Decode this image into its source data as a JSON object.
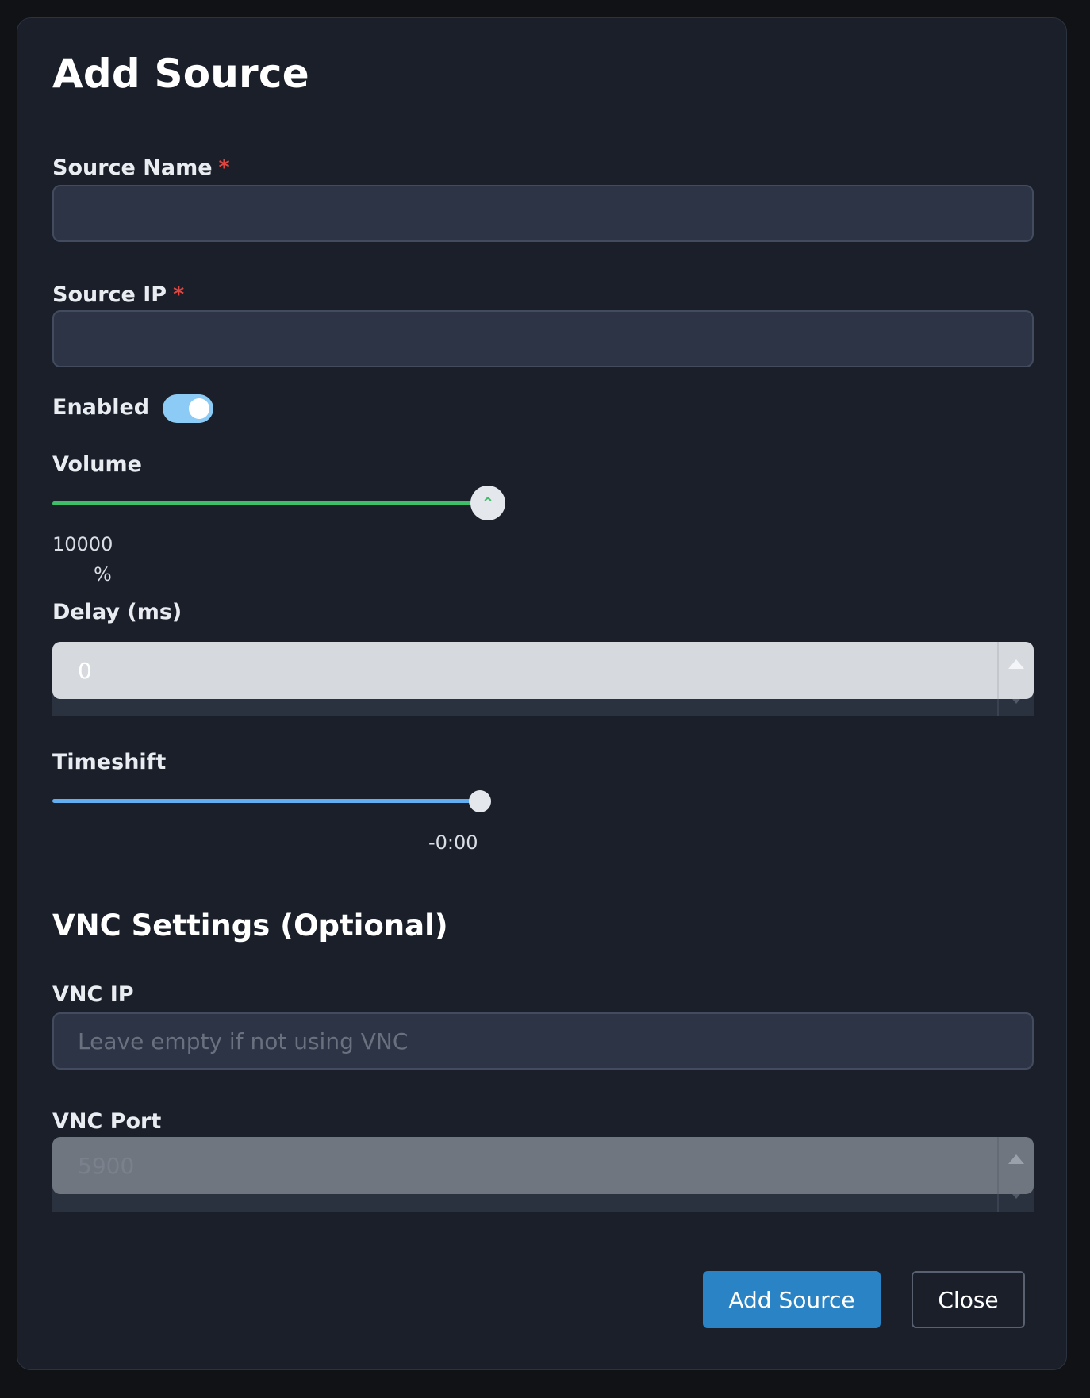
{
  "dialog": {
    "title": "Add Source",
    "source_name": {
      "label": "Source Name",
      "required_mark": "*",
      "value": ""
    },
    "source_ip": {
      "label": "Source IP",
      "required_mark": "*",
      "value": ""
    },
    "enabled": {
      "label": "Enabled",
      "on": true
    },
    "volume": {
      "label": "Volume",
      "value_text": "10000",
      "unit": "%",
      "level_fraction": 1.0
    },
    "delay": {
      "label": "Delay (ms)",
      "value": "0"
    },
    "timeshift": {
      "label": "Timeshift",
      "value_text": "-0:00",
      "level_fraction": 1.0
    },
    "vnc_section_title": "VNC Settings (Optional)",
    "vnc_ip": {
      "label": "VNC IP",
      "placeholder": "Leave empty if not using VNC"
    },
    "vnc_port": {
      "label": "VNC Port",
      "value": "5900"
    },
    "add_button_label": "Add Source",
    "close_button_label": "Close"
  },
  "colors": {
    "accent_blue": "#2a83c4",
    "toggle_on": "#8ccbf5",
    "volume_track": "#3fbe6a",
    "timeshift_track": "#63aef0",
    "required_red": "#e0463f"
  },
  "icons": {
    "volume_thumb": "chevron-up-icon",
    "spinner_up": "triangle-up-icon",
    "spinner_down": "triangle-down-icon"
  }
}
